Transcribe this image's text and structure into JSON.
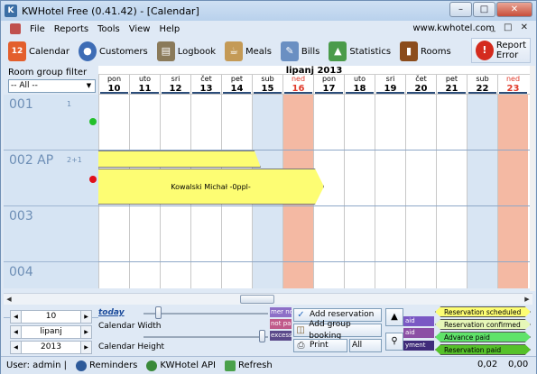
{
  "window": {
    "title": "KWHotel Free (0.41.42) - [Calendar]",
    "controls": [
      "–",
      "□",
      "✕"
    ]
  },
  "menu": {
    "items": [
      "File",
      "Reports",
      "Tools",
      "View",
      "Help"
    ],
    "site": "www.kwhotel.com",
    "mdi": "_ □ ✕"
  },
  "toolbar": {
    "calendar_day": "12",
    "buttons": [
      "Calendar",
      "Customers",
      "Logbook",
      "Meals",
      "Bills",
      "Statistics",
      "Rooms"
    ],
    "report_error_1": "Report",
    "report_error_2": "Error"
  },
  "filter": {
    "label": "Room group filter",
    "value": "-- All --"
  },
  "calendar": {
    "month": "lipanj  2013",
    "days": [
      {
        "wd": "pon",
        "d": "10",
        "type": "weekday"
      },
      {
        "wd": "uto",
        "d": "11",
        "type": "weekday"
      },
      {
        "wd": "sri",
        "d": "12",
        "type": "weekday"
      },
      {
        "wd": "čet",
        "d": "13",
        "type": "weekday"
      },
      {
        "wd": "pet",
        "d": "14",
        "type": "weekday"
      },
      {
        "wd": "sub",
        "d": "15",
        "type": "sat"
      },
      {
        "wd": "ned",
        "d": "16",
        "type": "sun"
      },
      {
        "wd": "pon",
        "d": "17",
        "type": "weekday"
      },
      {
        "wd": "uto",
        "d": "18",
        "type": "weekday"
      },
      {
        "wd": "sri",
        "d": "19",
        "type": "weekday"
      },
      {
        "wd": "čet",
        "d": "20",
        "type": "weekday"
      },
      {
        "wd": "pet",
        "d": "21",
        "type": "weekday"
      },
      {
        "wd": "sub",
        "d": "22",
        "type": "sat"
      },
      {
        "wd": "ned",
        "d": "23",
        "type": "sun"
      }
    ],
    "rooms": [
      {
        "name": "001",
        "capacity": "1",
        "status": "green"
      },
      {
        "name": "002 AP",
        "capacity": "2+1",
        "status": "red"
      },
      {
        "name": "003",
        "capacity": "",
        "status": ""
      },
      {
        "name": "004",
        "capacity": "",
        "status": ""
      }
    ],
    "reservation_label": "Kowalski Michał -0ppl-"
  },
  "colors": {
    "status_green": "#22c02a",
    "status_red": "#e0101a",
    "reservation": "#fdfd73",
    "saturday": "#d8e5f3",
    "sunday": "#f4b9a3"
  },
  "bottom": {
    "day": "10",
    "month": "lipanj",
    "year": "2013",
    "today": "today",
    "width_label": "Calendar Width",
    "height_label": "Calendar Height",
    "stripes": [
      "mer not",
      "not pa",
      "excess"
    ],
    "add_reservation": "Add reservation",
    "add_group": "Add group booking",
    "print": "Print",
    "all": "All",
    "partial_bars": [
      "aid",
      "aid",
      "yment"
    ],
    "legend": [
      {
        "label": "Reservation scheduled",
        "color": "#fdfd73"
      },
      {
        "label": "Reservation confirmed",
        "color": "#e6f7b8"
      },
      {
        "label": "Advance paid",
        "color": "#5fe36a"
      },
      {
        "label": "Reservation paid",
        "color": "#56c12a"
      }
    ]
  },
  "status": {
    "user": "User: admin |",
    "reminders": "Reminders",
    "api": "KWHotel API",
    "refresh": "Refresh",
    "value1": "0,02",
    "value2": "0,00"
  }
}
